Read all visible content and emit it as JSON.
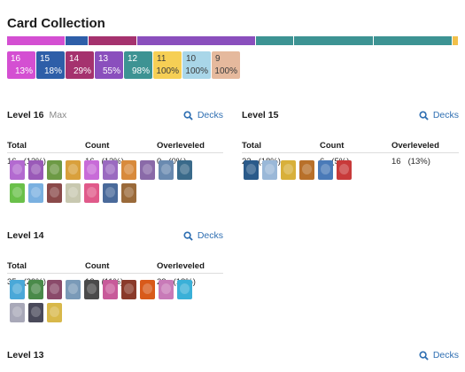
{
  "page": {
    "title": "Card Collection"
  },
  "bar_segments": [
    {
      "fraction": 0.13,
      "color": "#d44fd2"
    },
    {
      "fraction": 0.05,
      "color": "#2e5ea8"
    },
    {
      "fraction": 0.108,
      "color": "#a5326e"
    },
    {
      "fraction": 0.263,
      "color": "#8a4fbd"
    },
    {
      "fraction": 0.084,
      "color": "#3d9393"
    },
    {
      "fraction": 0.176,
      "color": "#3d9393"
    },
    {
      "fraction": 0.176,
      "color": "#3d9393"
    },
    {
      "fraction": 0.013,
      "color": "#f2c04a"
    }
  ],
  "chips": [
    {
      "level": "16",
      "percent": "13%",
      "color": "#d44fd2",
      "light": false
    },
    {
      "level": "15",
      "percent": "18%",
      "color": "#2e5ea8",
      "light": false
    },
    {
      "level": "14",
      "percent": "29%",
      "color": "#a5326e",
      "light": false
    },
    {
      "level": "13",
      "percent": "55%",
      "color": "#8a4fbd",
      "light": false
    },
    {
      "level": "12",
      "percent": "98%",
      "color": "#3d9393",
      "light": false
    },
    {
      "level": "11",
      "percent": "100%",
      "color": "#f6cf55",
      "light": true
    },
    {
      "level": "10",
      "percent": "100%",
      "color": "#a9d6e8",
      "light": true
    },
    {
      "level": "9",
      "percent": "100%",
      "color": "#e5b99d",
      "light": true
    }
  ],
  "labels": {
    "total": "Total",
    "count": "Count",
    "overleveled": "Overleveled",
    "decks": "Decks"
  },
  "sections": {
    "l16": {
      "title": "Level 16",
      "subtitle": "Max",
      "total": "16",
      "total_pct": "(13%)",
      "count": "16",
      "count_pct": "(13%)",
      "overleveled": "0",
      "overleveled_pct": "(0%)",
      "cards": [
        "#b36ad0",
        "#9a5ab8",
        "#6d9a45",
        "#d9a03c",
        "#c86bd8",
        "#9a6ac0",
        "#d88a3c",
        "#8a6aa8",
        "#6a8ab0",
        "#3a6a8a",
        "#6ac04a",
        "#7ab0e0",
        "#8a4a4a",
        "#c8c8b0",
        "#e05a8a",
        "#4a6a9a",
        "#9a6a3a"
      ]
    },
    "l15": {
      "title": "Level 15",
      "total": "22",
      "total_pct": "(18%)",
      "count": "6",
      "count_pct": "(5%)",
      "overleveled": "16",
      "overleveled_pct": "(13%)",
      "cards": [
        "#2a5a8a",
        "#9ab8d8",
        "#d8b03a",
        "#b8702a",
        "#4a7ab8",
        "#c83a3a"
      ]
    },
    "l14": {
      "title": "Level 14",
      "total": "35",
      "total_pct": "(29%)",
      "count": "13",
      "count_pct": "(11%)",
      "overleveled": "22",
      "overleveled_pct": "(18%)",
      "cards": [
        "#4aa8d8",
        "#4a8a4a",
        "#8a4a6a",
        "#7a9ab8",
        "#4a4a4a",
        "#c85a9a",
        "#8a3a2a",
        "#d85a1a",
        "#c87ab8",
        "#3ab0d8",
        "#a8a8b8",
        "#4a4a5a",
        "#d8b84a"
      ]
    },
    "l13": {
      "title": "Level 13"
    }
  }
}
